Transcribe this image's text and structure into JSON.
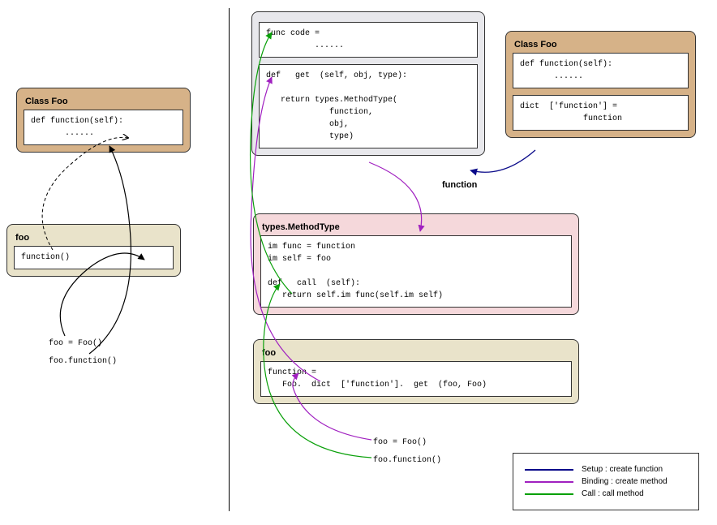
{
  "left": {
    "classFoo": {
      "title": "Class Foo",
      "code": "def function(self):\n       ......"
    },
    "foo": {
      "title": "foo",
      "code": "function()"
    },
    "caption1": "foo = Foo()",
    "caption2": "foo.function()"
  },
  "right": {
    "function": {
      "label": "function",
      "funcCode": "func code =\n          ......",
      "getDef": "def   get  (self, obj, type):\n\n   return types.MethodType(\n             function,\n             obj,\n             type)"
    },
    "classFoo": {
      "title": "Class Foo",
      "code": "def function(self):\n       ......",
      "dict": "dict  ['function'] =\n             function"
    },
    "methodType": {
      "title": "types.MethodType",
      "body": "im func = function\nim self = foo\n\ndef   call  (self):\n   return self.im func(self.im self)"
    },
    "foo": {
      "title": "foo",
      "body": "function =\n   Foo.  dict  ['function'].  get  (foo, Foo)"
    },
    "caption1": "foo = Foo()",
    "caption2": "foo.function()"
  },
  "legend": {
    "setup": "Setup : create function",
    "binding": "Binding : create method",
    "call": "Call : call method"
  },
  "colors": {
    "tan": "#d6b288",
    "beige": "#e9e3ca",
    "grey": "#e8e8ec",
    "pink": "#f5d8db",
    "setup": "#0b0b8a",
    "binding": "#a020c0",
    "call": "#0aa00a"
  }
}
